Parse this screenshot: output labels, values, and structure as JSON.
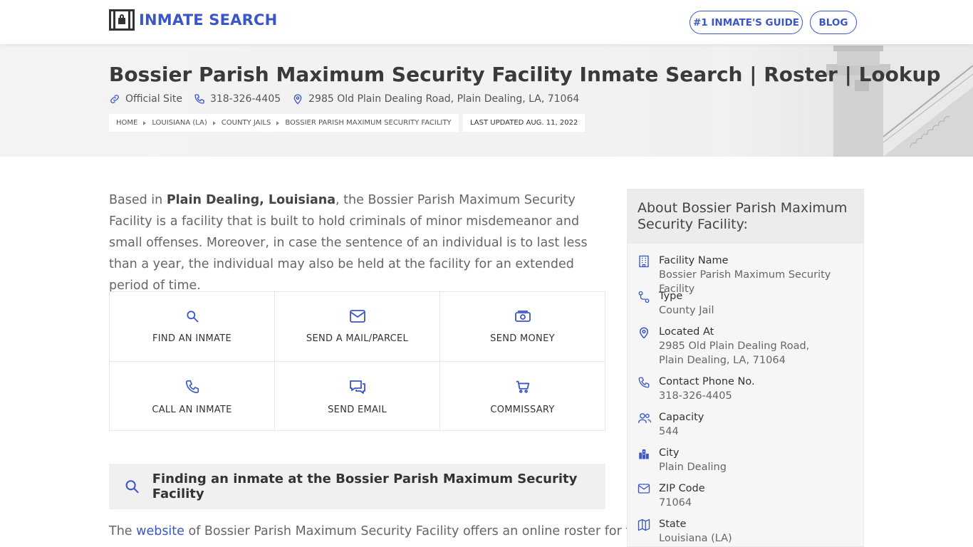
{
  "header": {
    "logo_text": "INMATE SEARCH",
    "nav": [
      {
        "label": "#1 INMATE'S GUIDE"
      },
      {
        "label": "BLOG"
      }
    ]
  },
  "hero": {
    "title": "Bossier Parish Maximum Security Facility Inmate Search | Roster | Lookup",
    "official_site": "Official Site",
    "phone": "318-326-4405",
    "address": "2985 Old Plain Dealing Road, Plain Dealing, LA, 71064",
    "breadcrumbs": [
      "HOME",
      "LOUISIANA (LA)",
      "COUNTY JAILS",
      "BOSSIER PARISH MAXIMUM SECURITY FACILITY"
    ],
    "last_updated": "LAST UPDATED AUG. 11, 2022"
  },
  "intro": {
    "pre": "Based in ",
    "location": "Plain Dealing, Louisiana",
    "post": ", the Bossier Parish Maximum Security Facility is a facility that is built to hold criminals of minor misdemeanor and small offenses. Moreover, in case the sentence of an individual is to last less than a year, the individual may also be held at the facility for an extended period of time."
  },
  "actions": [
    {
      "label": "FIND AN INMATE",
      "icon": "search-icon"
    },
    {
      "label": "SEND A MAIL/PARCEL",
      "icon": "mail-icon"
    },
    {
      "label": "SEND MONEY",
      "icon": "money-icon"
    },
    {
      "label": "CALL AN INMATE",
      "icon": "phone-icon"
    },
    {
      "label": "SEND EMAIL",
      "icon": "chat-icon"
    },
    {
      "label": "COMMISSARY",
      "icon": "cart-icon"
    }
  ],
  "finding": {
    "title": "Finding an inmate at the Bossier Parish Maximum Security Facility"
  },
  "para2": {
    "pre": "The ",
    "link": "website",
    "post": " of Bossier Parish Maximum Security Facility offers an online roster for the"
  },
  "sidebar": {
    "title": "About Bossier Parish Maximum Security Facility:",
    "rows": [
      {
        "label": "Facility Name",
        "value": "Bossier Parish Maximum Security Facility",
        "icon": "building-icon"
      },
      {
        "label": "Type",
        "value": "County Jail",
        "icon": "route-icon"
      },
      {
        "label": "Located At",
        "value": "2985 Old Plain Dealing Road, Plain Dealing, LA, 71064",
        "icon": "map-pin-icon"
      },
      {
        "label": "Contact Phone No.",
        "value": "318-326-4405",
        "icon": "phone-icon"
      },
      {
        "label": "Capacity",
        "value": "544",
        "icon": "users-icon"
      },
      {
        "label": "City",
        "value": "Plain Dealing",
        "icon": "city-icon"
      },
      {
        "label": "ZIP Code",
        "value": "71064",
        "icon": "mail-icon"
      },
      {
        "label": "State",
        "value": "Louisiana (LA)",
        "icon": "map-icon"
      }
    ]
  },
  "colors": {
    "accent": "#3a56c8",
    "text_dark": "#333333",
    "text_body": "#666666"
  }
}
